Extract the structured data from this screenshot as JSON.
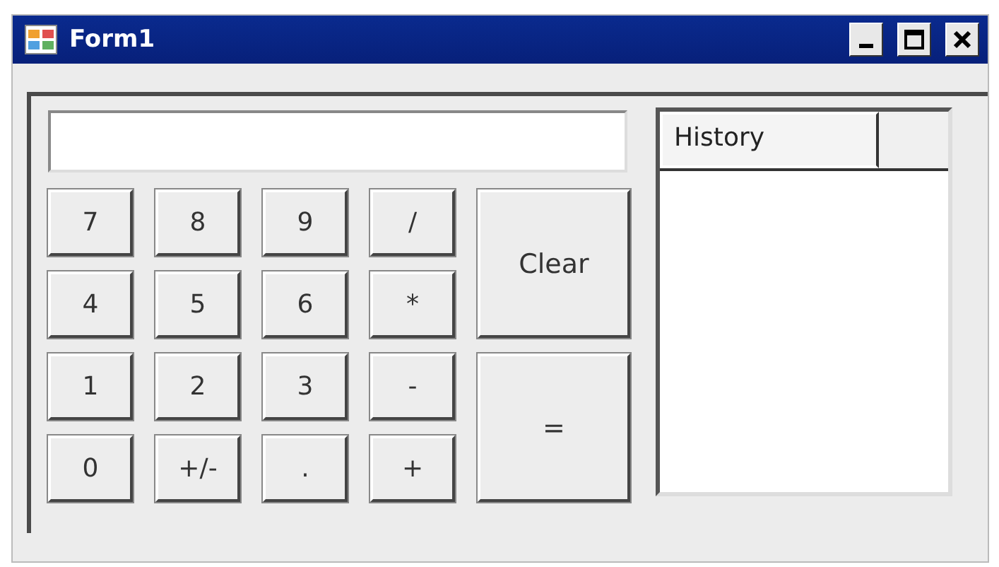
{
  "window": {
    "title": "Form1"
  },
  "keypad": [
    [
      "7",
      "8",
      "9",
      "/"
    ],
    [
      "4",
      "5",
      "6",
      "*"
    ],
    [
      "1",
      "2",
      "3",
      "-"
    ],
    [
      "0",
      "+/-",
      ".",
      "+"
    ]
  ],
  "side_buttons": [
    "Clear",
    "="
  ],
  "history": {
    "columns": [
      "History"
    ]
  }
}
